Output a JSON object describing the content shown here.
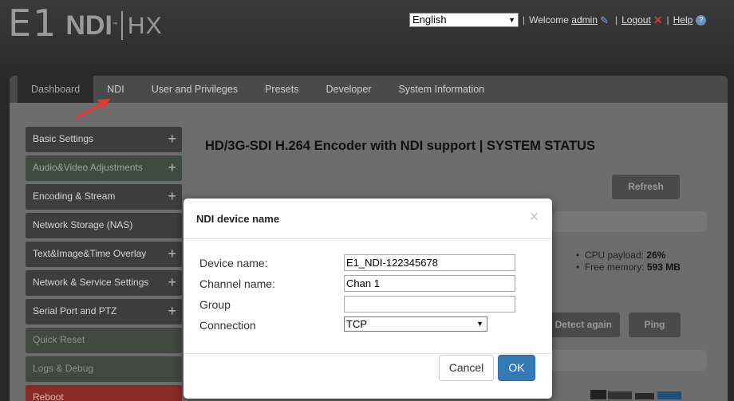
{
  "brand": {
    "e1": "E1",
    "ndi": "NDI",
    "tm": "™",
    "hx": "HX"
  },
  "topbar": {
    "language": "English",
    "welcome": "Welcome",
    "user": "admin",
    "logout": "Logout",
    "help": "Help"
  },
  "tabs": [
    {
      "label": "Dashboard"
    },
    {
      "label": "NDI"
    },
    {
      "label": "User and Privileges"
    },
    {
      "label": "Presets"
    },
    {
      "label": "Developer"
    },
    {
      "label": "System Information"
    }
  ],
  "sidebar": {
    "items": [
      {
        "label": "Basic Settings"
      },
      {
        "label": "Audio&Video Adjustments"
      },
      {
        "label": "Encoding & Stream"
      },
      {
        "label": "Network Storage (NAS)"
      },
      {
        "label": "Text&Image&Time Overlay"
      },
      {
        "label": "Network & Service Settings"
      },
      {
        "label": "Serial Port and PTZ"
      },
      {
        "label": "Quick Reset"
      },
      {
        "label": "Logs & Debug"
      },
      {
        "label": "Reboot"
      }
    ]
  },
  "content": {
    "title": "HD/3G-SDI H.264 Encoder with NDI support | SYSTEM STATUS",
    "refresh": "Refresh",
    "detect_again": "Detect again",
    "ping": "Ping",
    "cpu_label": "CPU payload:",
    "cpu_value": "26%",
    "mem_label": "Free memory:",
    "mem_value": "593 MB"
  },
  "modal": {
    "title": "NDI device name",
    "close": "×",
    "fields": {
      "device_name_label": "Device name:",
      "device_name_value": "E1_NDI-122345678",
      "channel_name_label": "Channel name:",
      "channel_name_value": "Chan 1",
      "group_label": "Group",
      "group_value": "",
      "connection_label": "Connection",
      "connection_value": "TCP"
    },
    "cancel": "Cancel",
    "ok": "OK"
  },
  "colors": {
    "accent": "#337ab7",
    "reboot": "#8a2a24",
    "callout_arrow": "#e53935"
  }
}
